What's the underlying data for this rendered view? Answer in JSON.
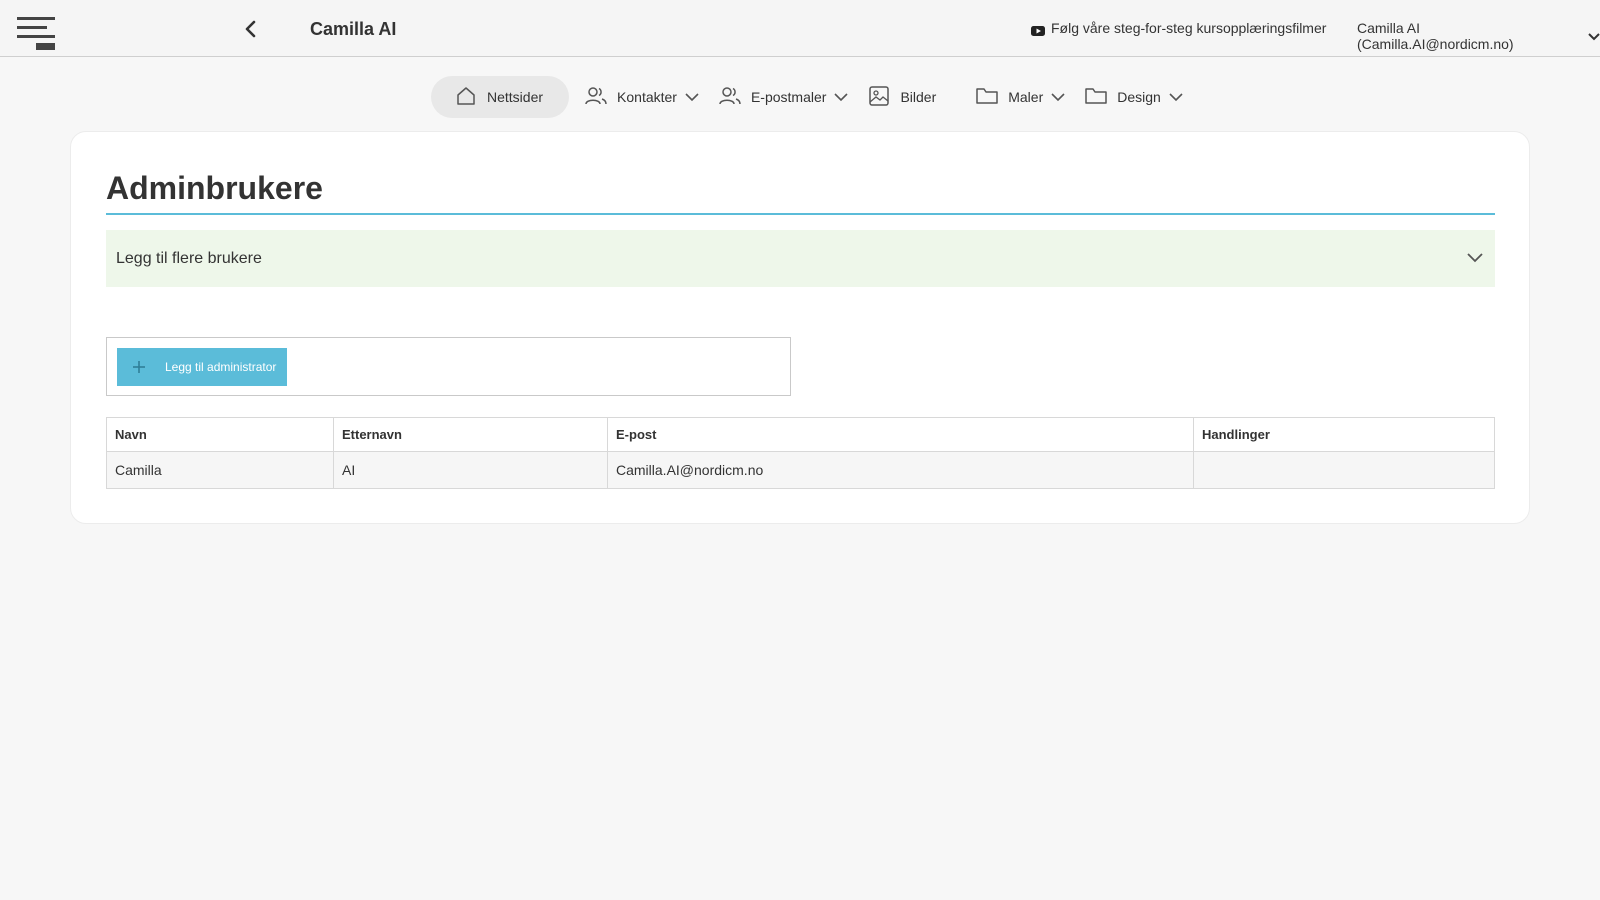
{
  "header": {
    "title": "Camilla AI",
    "tutorial_link": "Følg våre steg-for-steg kursopplæringsfilmer",
    "user_label": "Camilla AI (Camilla.AI@nordicm.no)"
  },
  "nav": {
    "items": [
      {
        "label": "Nettsider",
        "icon": "home-icon"
      },
      {
        "label": "Kontakter",
        "icon": "users-icon"
      },
      {
        "label": "E-postmaler",
        "icon": "users-icon"
      },
      {
        "label": "Bilder",
        "icon": "image-icon"
      },
      {
        "label": "Maler",
        "icon": "folder-icon"
      },
      {
        "label": "Design",
        "icon": "folder-icon"
      }
    ]
  },
  "main": {
    "title": "Adminbrukere",
    "accordion_label": "Legg til flere brukere",
    "add_button_label": "Legg til administrator",
    "table": {
      "columns": [
        "Navn",
        "Etternavn",
        "E-post",
        "Handlinger"
      ],
      "rows": [
        [
          "Camilla",
          "AI",
          "Camilla.AI@nordicm.no",
          ""
        ]
      ]
    }
  },
  "colors": {
    "accent": "#5bbcd9",
    "accordion_bg": "#eef7ea",
    "page_bg": "#f7f7f7"
  }
}
